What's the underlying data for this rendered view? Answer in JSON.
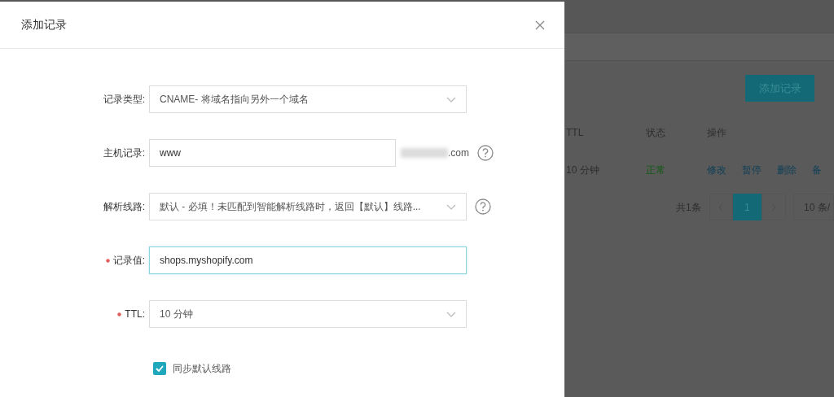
{
  "dialog": {
    "title": "添加记录",
    "fields": [
      {
        "kind": "select",
        "label": "记录类型:",
        "required": false,
        "value": "CNAME- 将域名指向另外一个域名",
        "help": false
      },
      {
        "kind": "input",
        "label": "主机记录:",
        "required": false,
        "value": "www",
        "suffix": ".com",
        "help": true
      },
      {
        "kind": "select",
        "label": "解析线路:",
        "required": false,
        "value": "默认 - 必填！未匹配到智能解析线路时，返回【默认】线路...",
        "help": true
      },
      {
        "kind": "input",
        "label": "记录值:",
        "required": true,
        "value": "shops.myshopify.com",
        "focused": true,
        "help": false
      },
      {
        "kind": "select",
        "label": "TTL:",
        "required": true,
        "value": "10 分钟",
        "help": false
      }
    ],
    "checkbox": {
      "label": "同步默认线路",
      "checked": true
    }
  },
  "background": {
    "add_button": "添加记录",
    "columns": [
      "TTL",
      "状态",
      "操作"
    ],
    "row": {
      "ttl": "10 分钟",
      "status": "正常",
      "actions": [
        "修改",
        "暂停",
        "删除",
        "备"
      ]
    },
    "pagination": {
      "total": "共1条",
      "pages": [
        {
          "label": "1",
          "selected": true
        }
      ],
      "page_size": "10 条/"
    }
  }
}
